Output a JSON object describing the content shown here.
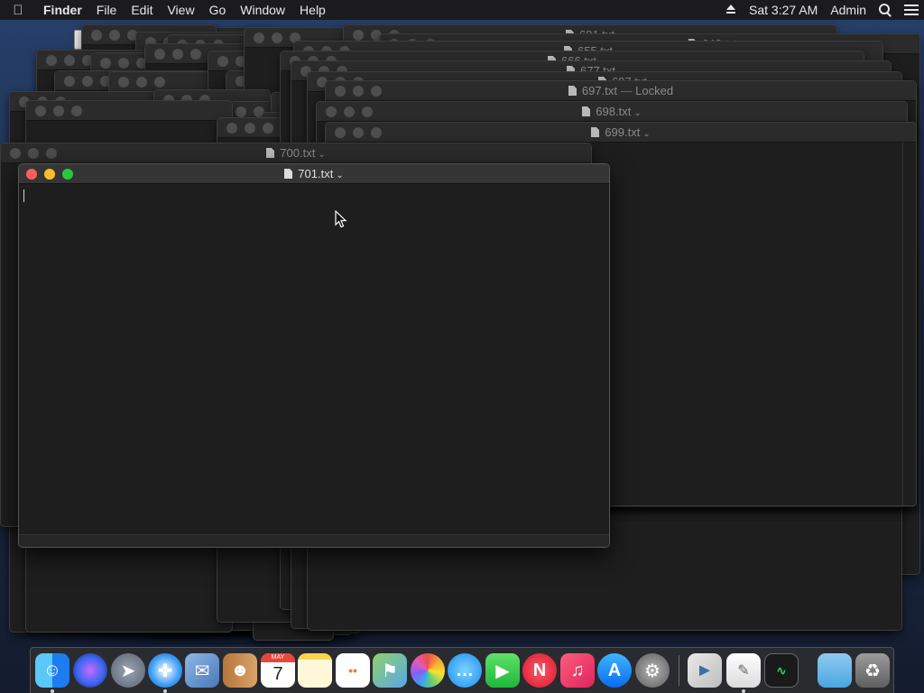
{
  "menubar": {
    "app_name": "Finder",
    "menus": [
      "File",
      "Edit",
      "View",
      "Go",
      "Window",
      "Help"
    ],
    "clock": "Sat 3:27 AM",
    "user": "Admin"
  },
  "windows": {
    "titles": {
      "w691": "691.txt",
      "w643": "643.txt",
      "w655": "655.txt",
      "w666": "666.txt",
      "w677": "677.txt",
      "w697d": "697.txt",
      "w697": "697.txt",
      "w697_status": "Locked",
      "w698": "698.txt",
      "w699": "699.txt",
      "w700": "700.txt"
    }
  },
  "front_window": {
    "title": "701.txt",
    "content": ""
  },
  "dock": {
    "items": [
      {
        "name": "finder",
        "icon": "finder-icon",
        "running": true
      },
      {
        "name": "siri",
        "icon": "siri-icon",
        "running": false
      },
      {
        "name": "launchpad",
        "icon": "rocket-icon",
        "running": false
      },
      {
        "name": "safari",
        "icon": "compass-icon",
        "running": true
      },
      {
        "name": "mail",
        "icon": "stamp-icon",
        "running": false
      },
      {
        "name": "contacts",
        "icon": "contacts-book-icon",
        "running": false
      },
      {
        "name": "calendar",
        "icon": "calendar-icon",
        "month": "MAY",
        "day": "7",
        "running": false
      },
      {
        "name": "notes",
        "icon": "notepad-icon",
        "running": false
      },
      {
        "name": "reminders",
        "icon": "checklist-icon",
        "running": false
      },
      {
        "name": "maps",
        "icon": "map-icon",
        "running": false
      },
      {
        "name": "photos",
        "icon": "pinwheel-icon",
        "running": false
      },
      {
        "name": "messages",
        "icon": "speech-bubble-icon",
        "running": false
      },
      {
        "name": "facetime",
        "icon": "video-camera-icon",
        "running": false
      },
      {
        "name": "news",
        "icon": "news-icon",
        "running": false
      },
      {
        "name": "music",
        "icon": "music-note-icon",
        "running": false
      },
      {
        "name": "app-store",
        "icon": "app-store-icon",
        "running": false
      },
      {
        "name": "system-preferences",
        "icon": "gear-icon",
        "running": false
      },
      {
        "name": "python-launcher",
        "icon": "python-icon",
        "running": false
      },
      {
        "name": "textedit",
        "icon": "textedit-icon",
        "running": true
      },
      {
        "name": "activity-monitor",
        "icon": "activity-monitor-icon",
        "running": false
      },
      {
        "name": "downloads-folder",
        "icon": "folder-icon",
        "running": false
      },
      {
        "name": "trash",
        "icon": "trash-icon",
        "running": false
      }
    ]
  },
  "colors": {
    "close": "#fc5f57",
    "minimize": "#fdbc2e",
    "zoom": "#28c83f"
  }
}
